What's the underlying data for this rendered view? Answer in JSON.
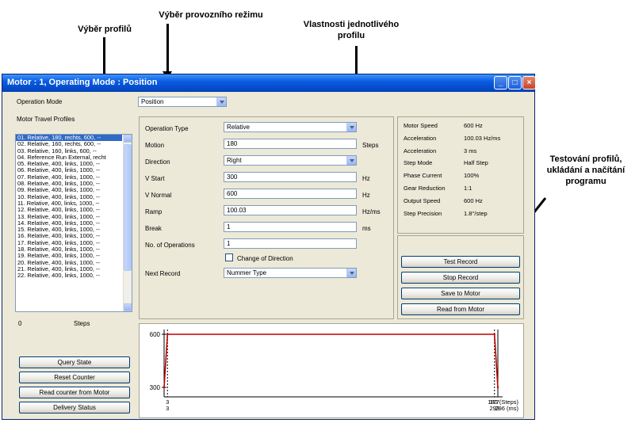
{
  "annotations": {
    "profile_select": "Výběr profilů",
    "operating_mode_select": "Výběr provozního režimu",
    "profile_properties": "Vlastnosti jednotlivého profilu",
    "testing": "Testování profilů, ukládání a načítání programu"
  },
  "window": {
    "title": "Motor : 1, Operating Mode : Position"
  },
  "left": {
    "operation_mode_label": "Operation Mode",
    "operation_mode_value": "Position",
    "profiles_label": "Motor Travel Profiles",
    "profiles": [
      "01. Relative, 180, rechts, 600, --",
      "02. Relative, 160, rechts, 600, --",
      "03. Relative, 160, links, 600, --",
      "04. Reference Run External, recht",
      "05. Relative, 400, links, 1000, --",
      "06. Relative, 400, links, 1000, --",
      "07. Relative, 400, links, 1000, --",
      "08. Relative, 400, links, 1000, --",
      "09. Relative, 400, links, 1000, --",
      "10. Relative, 400, links, 1000, --",
      "11. Relative, 400, links, 1000, --",
      "12. Relative, 400, links, 1000, --",
      "13. Relative, 400, links, 1000, --",
      "14. Relative, 400, links, 1000, --",
      "15. Relative, 400, links, 1000, --",
      "16. Relative, 400, links, 1000, --",
      "17. Relative, 400, links, 1000, --",
      "18. Relative, 400, links, 1000, --",
      "19. Relative, 400, links, 1000, --",
      "20. Relative, 400, links, 1000, --",
      "21. Relative, 400, links, 1000, --",
      "22. Relative, 400, links, 1000, --"
    ],
    "counter_value": "0",
    "counter_unit": "Steps",
    "buttons": [
      "Query State",
      "Reset Counter",
      "Read counter from Motor",
      "Delivery Status"
    ]
  },
  "form": {
    "operation_type": {
      "label": "Operation Type",
      "value": "Relative"
    },
    "motion": {
      "label": "Motion",
      "value": "180",
      "unit": "Steps"
    },
    "direction": {
      "label": "Direction",
      "value": "Right"
    },
    "v_start": {
      "label": "V Start",
      "value": "300",
      "unit": "Hz"
    },
    "v_normal": {
      "label": "V Normal",
      "value": "600",
      "unit": "Hz"
    },
    "ramp": {
      "label": "Ramp",
      "value": "100.03",
      "unit": "Hz/ms"
    },
    "break": {
      "label": "Break",
      "value": "1",
      "unit": "ms"
    },
    "no_operations": {
      "label": "No. of Operations",
      "value": "1"
    },
    "change_direction": {
      "label": "Change of Direction",
      "checked": false
    },
    "next_record": {
      "label": "Next Record",
      "value": "Nummer Type"
    }
  },
  "properties": [
    {
      "name": "Motor Speed",
      "value": "600 Hz"
    },
    {
      "name": "Acceleration",
      "value": "100.03 Hz/ms"
    },
    {
      "name": "Acceleration",
      "value": "3 ms"
    },
    {
      "name": "Step Mode",
      "value": "Half Step"
    },
    {
      "name": "Phase Current",
      "value": "100%"
    },
    {
      "name": "Gear Reduction",
      "value": "1:1"
    },
    {
      "name": "Output Speed",
      "value": "600 Hz"
    },
    {
      "name": "Step Precision",
      "value": "1.8°/step"
    }
  ],
  "actions": [
    "Test Record",
    "Stop Record",
    "Save to Motor",
    "Read from Motor"
  ],
  "chart_data": {
    "type": "line",
    "title": "",
    "xlabel": "",
    "ylabel": "",
    "y_ticks": [
      "600",
      "300"
    ],
    "x_ticks": [
      {
        "steps": "3",
        "ms": "3"
      },
      {
        "steps": "177",
        "ms": "293"
      },
      {
        "steps": "180 (Steps)",
        "ms": "296 (ms)"
      }
    ],
    "x": [
      0,
      3,
      293,
      296
    ],
    "y": [
      300,
      600,
      600,
      300
    ],
    "xlim": [
      0,
      296
    ],
    "ylim": [
      300,
      600
    ],
    "line_color": "#c00000"
  }
}
